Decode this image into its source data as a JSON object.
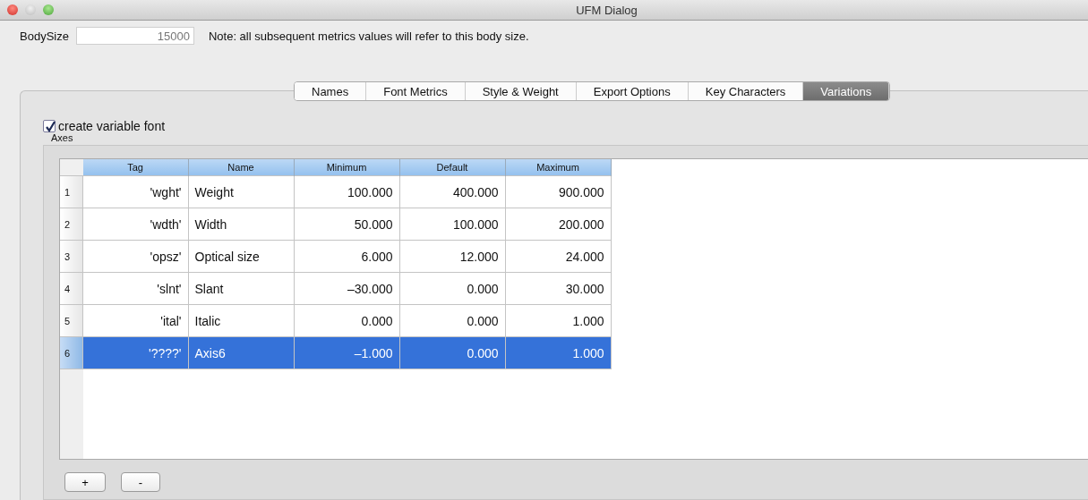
{
  "window": {
    "title": "UFM Dialog"
  },
  "body_size": {
    "label": "BodySize",
    "value": "15000",
    "note": "Note: all subsequent metrics values will refer to this body size."
  },
  "tabs": [
    {
      "label": "Names",
      "selected": false
    },
    {
      "label": "Font Metrics",
      "selected": false
    },
    {
      "label": "Style & Weight",
      "selected": false
    },
    {
      "label": "Export Options",
      "selected": false
    },
    {
      "label": "Key Characters",
      "selected": false
    },
    {
      "label": "Variations",
      "selected": true
    }
  ],
  "variable_font": {
    "label": "create variable font",
    "checked": true
  },
  "axes": {
    "title": "Axes",
    "columns": [
      "Tag",
      "Name",
      "Minimum",
      "Default",
      "Maximum"
    ],
    "rows": [
      {
        "number": "1",
        "cells": [
          "'wght'",
          "Weight",
          "100.000",
          "400.000",
          "900.000"
        ],
        "selected": false
      },
      {
        "number": "2",
        "cells": [
          "'wdth'",
          "Width",
          "50.000",
          "100.000",
          "200.000"
        ],
        "selected": false
      },
      {
        "number": "3",
        "cells": [
          "'opsz'",
          "Optical size",
          "6.000",
          "12.000",
          "24.000"
        ],
        "selected": false
      },
      {
        "number": "4",
        "cells": [
          "'slnt'",
          "Slant",
          "–30.000",
          "0.000",
          "30.000"
        ],
        "selected": false
      },
      {
        "number": "5",
        "cells": [
          "'ital'",
          "Italic",
          "0.000",
          "0.000",
          "1.000"
        ],
        "selected": false
      },
      {
        "number": "6",
        "cells": [
          "'????'",
          "Axis6",
          "–1.000",
          "0.000",
          "1.000"
        ],
        "selected": true
      }
    ]
  },
  "buttons": [
    "+",
    "-"
  ]
}
